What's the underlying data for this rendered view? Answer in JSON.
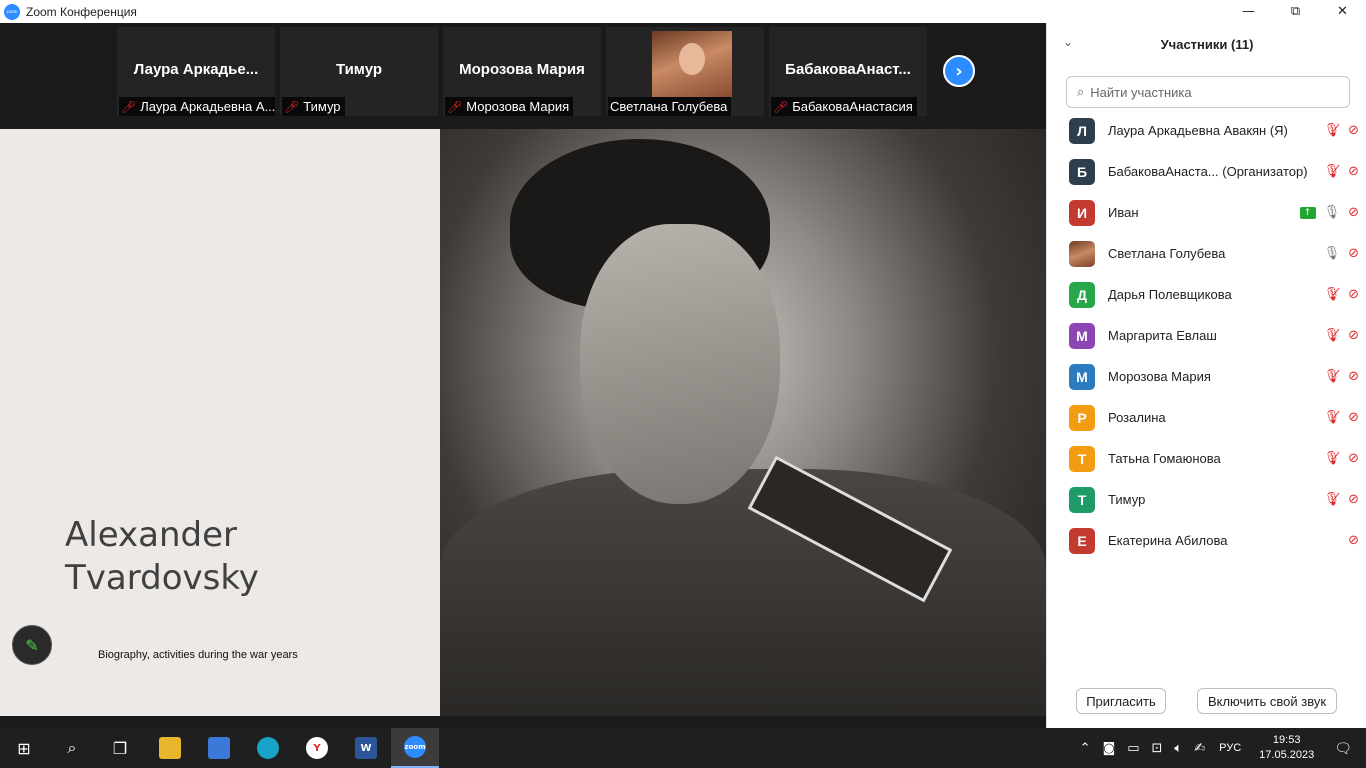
{
  "window": {
    "title": "Zoom Конференция",
    "logo_text": "zoom",
    "minimize": "—",
    "maximize": "⧉",
    "close": "✕"
  },
  "thumbnails": [
    {
      "name": "Лаура  Аркадье...",
      "label": "Лаура Аркадьевна А...",
      "muted": true
    },
    {
      "name": "Тимур",
      "label": "Тимур",
      "muted": true
    },
    {
      "name": "Морозова Мария",
      "label": "Морозова Мария",
      "muted": true
    },
    {
      "name": "",
      "label": "Светлана Голубева",
      "muted": false,
      "video": true
    },
    {
      "name": "БабаковаАнаст...",
      "label": "БабаковаАнастасия",
      "muted": true
    }
  ],
  "next_button": "›",
  "slide": {
    "title_line1": "Alexander",
    "title_line2": "Tvardovsky",
    "subtitle": "Biography, activities during the war years",
    "pencil_icon": "✎"
  },
  "panel": {
    "collapse_icon": "⌄",
    "title": "Участники (11)",
    "search_placeholder": "Найти участника",
    "participants": [
      {
        "initial": "Л",
        "name": "Лаура Аркадьевна Авакян (Я)",
        "color": "#2f3e4c",
        "mic": "muted",
        "share": false
      },
      {
        "initial": "Б",
        "name": "БабаковаАнаста...  (Организатор)",
        "color": "#2f3e4c",
        "mic": "muted",
        "share": false
      },
      {
        "initial": "И",
        "name": "Иван",
        "color": "#c33a2f",
        "mic": "on",
        "share": true
      },
      {
        "initial": "",
        "name": "Светлана Голубева",
        "color": "",
        "mic": "on",
        "share": false,
        "photo": true
      },
      {
        "initial": "Д",
        "name": "Дарья Полевщикова",
        "color": "#25a74a",
        "mic": "muted",
        "share": false
      },
      {
        "initial": "М",
        "name": "Маргарита Евлаш",
        "color": "#8b45b5",
        "mic": "muted",
        "share": false
      },
      {
        "initial": "М",
        "name": "Морозова Мария",
        "color": "#2b7bbf",
        "mic": "muted",
        "share": false
      },
      {
        "initial": "Р",
        "name": "Розалина",
        "color": "#f39c12",
        "mic": "muted",
        "share": false
      },
      {
        "initial": "Т",
        "name": "Татьна Гомаюнова",
        "color": "#f39c12",
        "mic": "muted",
        "share": false
      },
      {
        "initial": "Т",
        "name": "Тимур",
        "color": "#1f9b6a",
        "mic": "muted",
        "share": false
      },
      {
        "initial": "Е",
        "name": "Екатерина Абилова",
        "color": "#c33a2f",
        "mic": "none",
        "share": false
      }
    ],
    "invite_button": "Пригласить",
    "unmute_button": "Включить свой звук"
  },
  "taskbar": {
    "start_icon": "windows-icon",
    "search_icon": "search-icon",
    "apps": [
      "task-view-icon",
      "file-explorer-icon",
      "store-icon",
      "edge-icon",
      "yandex-icon",
      "word-icon",
      "zoom-icon"
    ],
    "word_letter": "W",
    "yandex_letter": "Y",
    "zoom_text": "zoom",
    "language": "РУС",
    "time": "19:53",
    "date": "17.05.2023"
  }
}
